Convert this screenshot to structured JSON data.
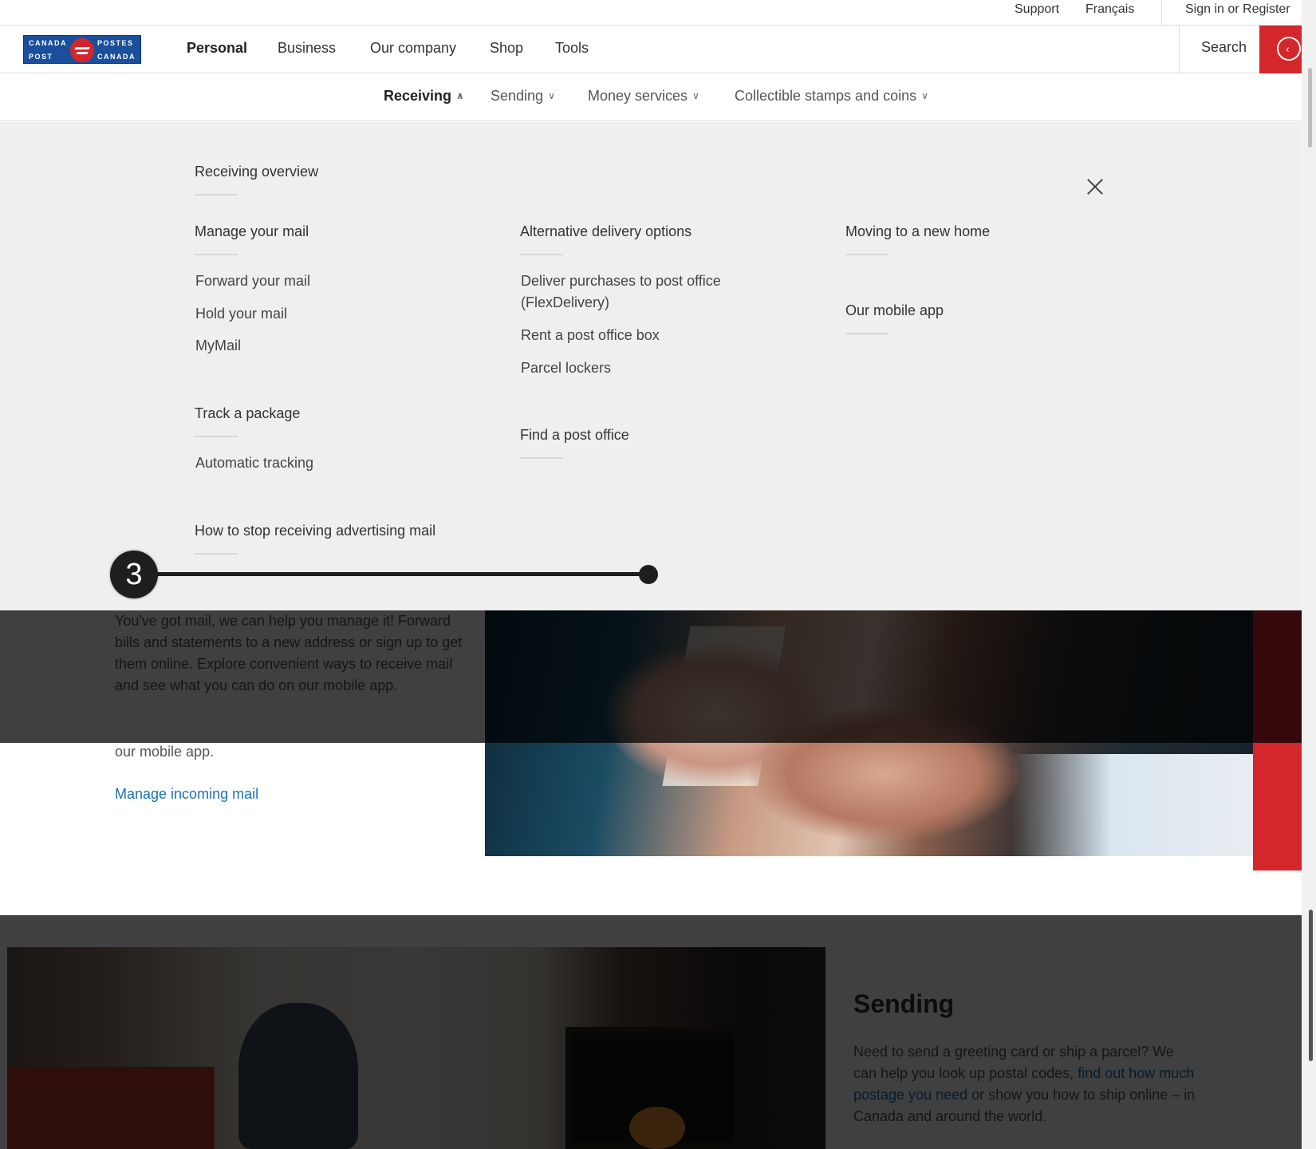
{
  "utility": {
    "support": "Support",
    "language": "Français",
    "sign_in": "Sign in or Register"
  },
  "logo": {
    "line1_left": "CANADA",
    "line1_right": "POSTES",
    "line2_left": "POST",
    "line2_right": "CANADA"
  },
  "main_nav": [
    "Personal",
    "Business",
    "Our company",
    "Shop",
    "Tools"
  ],
  "search": {
    "label": "Search",
    "button_icon": "chevron-left-icon",
    "accent": "#d3272c"
  },
  "sub_nav": [
    {
      "label": "Receiving",
      "chevron": "up"
    },
    {
      "label": "Sending",
      "chevron": "down"
    },
    {
      "label": "Money services",
      "chevron": "down"
    },
    {
      "label": "Collectible stamps and coins",
      "chevron": "down"
    }
  ],
  "mega_menu": {
    "overview": "Receiving overview",
    "col1": {
      "manage_heading": "Manage your mail",
      "manage_links": [
        "Forward your mail",
        "Hold your mail",
        "MyMail"
      ],
      "track_heading": "Track a package",
      "track_links": [
        "Automatic tracking"
      ],
      "stop_heading": "How to stop receiving advertising mail"
    },
    "col2": {
      "alt_heading": "Alternative delivery options",
      "alt_links": [
        "Deliver purchases to post office (FlexDelivery)",
        "Rent a post office box",
        "Parcel lockers"
      ],
      "find_heading": "Find a post office"
    },
    "col3": {
      "moving_heading": "Moving to a new home",
      "app_heading": "Our mobile app"
    }
  },
  "step_indicator": {
    "number": "3"
  },
  "receiving_section": {
    "text": "You've got mail, we can help you manage it! Forward bills and statements to a new address or sign up to get them online. Explore convenient ways to receive mail and see what you can do on our mobile app.",
    "text_tail": "our mobile app.",
    "link": "Manage incoming mail"
  },
  "sending_section": {
    "title": "Sending",
    "text_before": "Need to send a greeting card or ship a parcel? We can help you look up postal codes, ",
    "link": "find out how much postage you need",
    "text_after": " or show you how to ship online – in Canada and around the world."
  }
}
